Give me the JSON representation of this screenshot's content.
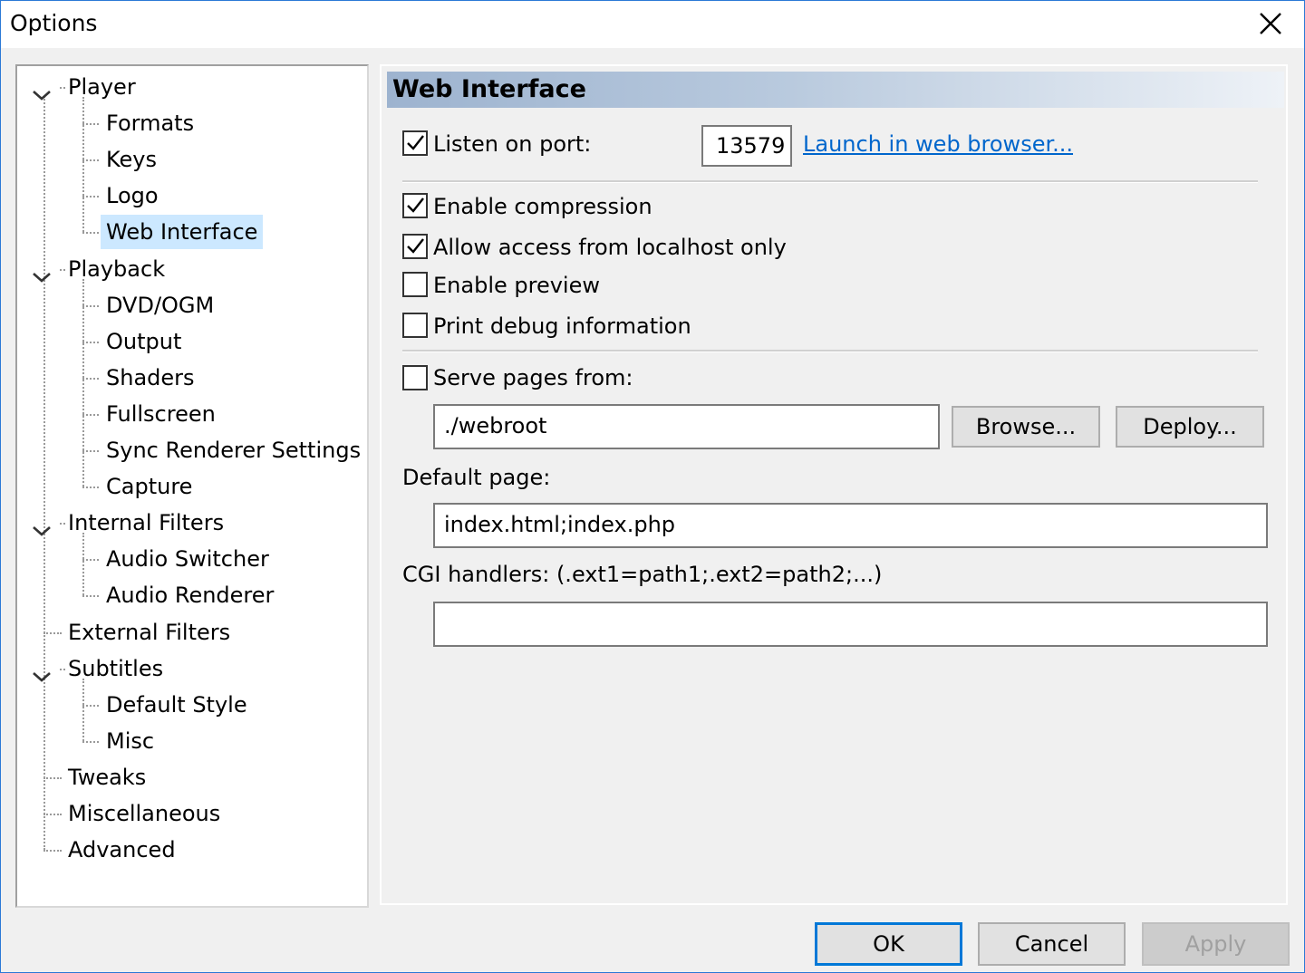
{
  "window": {
    "title": "Options"
  },
  "tree": {
    "items": [
      {
        "label": "Player",
        "level": 0,
        "expanded": true
      },
      {
        "label": "Formats",
        "level": 1
      },
      {
        "label": "Keys",
        "level": 1
      },
      {
        "label": "Logo",
        "level": 1
      },
      {
        "label": "Web Interface",
        "level": 1,
        "selected": true
      },
      {
        "label": "Playback",
        "level": 0,
        "expanded": true
      },
      {
        "label": "DVD/OGM",
        "level": 1
      },
      {
        "label": "Output",
        "level": 1
      },
      {
        "label": "Shaders",
        "level": 1
      },
      {
        "label": "Fullscreen",
        "level": 1
      },
      {
        "label": "Sync Renderer Settings",
        "level": 1
      },
      {
        "label": "Capture",
        "level": 1
      },
      {
        "label": "Internal Filters",
        "level": 0,
        "expanded": true
      },
      {
        "label": "Audio Switcher",
        "level": 1
      },
      {
        "label": "Audio Renderer",
        "level": 1
      },
      {
        "label": "External Filters",
        "level": 0
      },
      {
        "label": "Subtitles",
        "level": 0,
        "expanded": true
      },
      {
        "label": "Default Style",
        "level": 1
      },
      {
        "label": "Misc",
        "level": 1
      },
      {
        "label": "Tweaks",
        "level": 0
      },
      {
        "label": "Miscellaneous",
        "level": 0
      },
      {
        "label": "Advanced",
        "level": 0
      }
    ]
  },
  "page": {
    "heading": "Web Interface",
    "listen_label": "Listen on port:",
    "listen_checked": true,
    "port_value": "13579",
    "launch_link": "Launch in web browser...",
    "compression_label": "Enable compression",
    "compression_checked": true,
    "localhost_label": "Allow access from localhost only",
    "localhost_checked": true,
    "preview_label": "Enable preview",
    "preview_checked": false,
    "debug_label": "Print debug information",
    "debug_checked": false,
    "serve_label": "Serve pages from:",
    "serve_checked": false,
    "serve_path": "./webroot",
    "browse_label": "Browse...",
    "deploy_label": "Deploy...",
    "default_page_label": "Default page:",
    "default_page_value": "index.html;index.php",
    "cgi_label": "CGI handlers: (.ext1=path1;.ext2=path2;...)",
    "cgi_value": ""
  },
  "footer": {
    "ok_label": "OK",
    "cancel_label": "Cancel",
    "apply_label": "Apply"
  },
  "colors": {
    "selection": "#cce8ff",
    "link": "#0066cc",
    "accent": "#0078d7"
  }
}
